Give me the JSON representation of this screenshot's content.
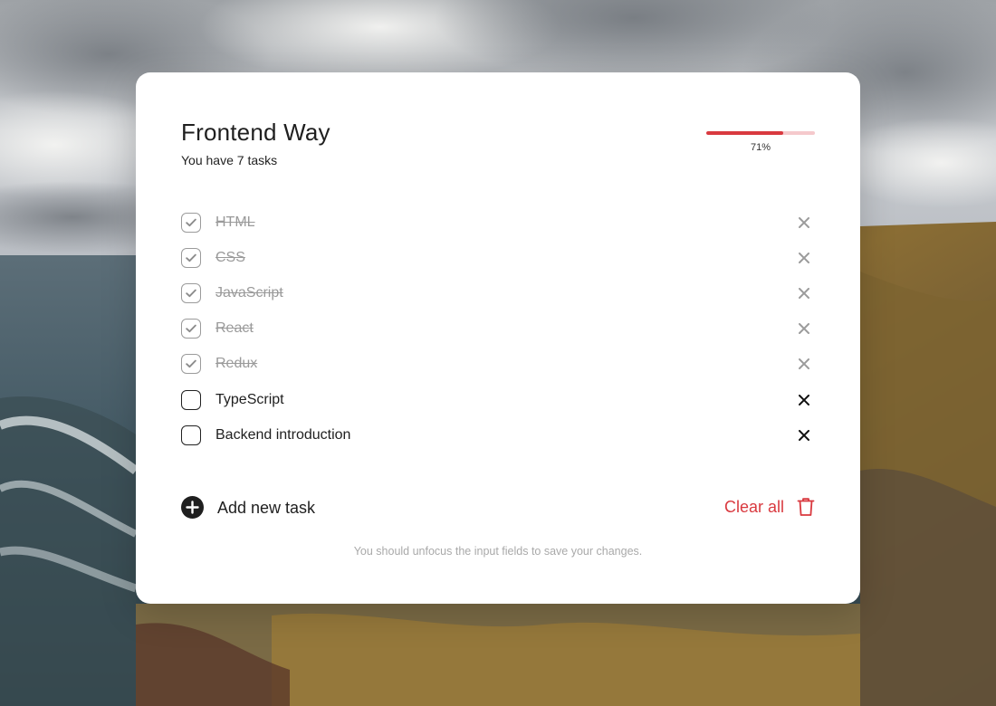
{
  "title": "Frontend Way",
  "subtitle": "You have 7 tasks",
  "progress": {
    "percent": 71,
    "label": "71%"
  },
  "tasks": [
    {
      "label": "HTML",
      "done": true
    },
    {
      "label": "CSS",
      "done": true
    },
    {
      "label": "JavaScript",
      "done": true
    },
    {
      "label": "React",
      "done": true
    },
    {
      "label": "Redux",
      "done": true
    },
    {
      "label": "TypeScript",
      "done": false
    },
    {
      "label": "Backend introduction",
      "done": false
    }
  ],
  "actions": {
    "add_label": "Add new task",
    "clear_label": "Clear all"
  },
  "hint": "You should unfocus the input fields to save your changes.",
  "icons": {
    "check": "check-icon",
    "remove": "close-icon",
    "add": "plus-circle-icon",
    "trash": "trash-icon"
  },
  "colors": {
    "accent": "#d9393f",
    "accent_light": "#f5c9cc",
    "done_text": "#9a9a9a",
    "text": "#1f1f1f"
  }
}
